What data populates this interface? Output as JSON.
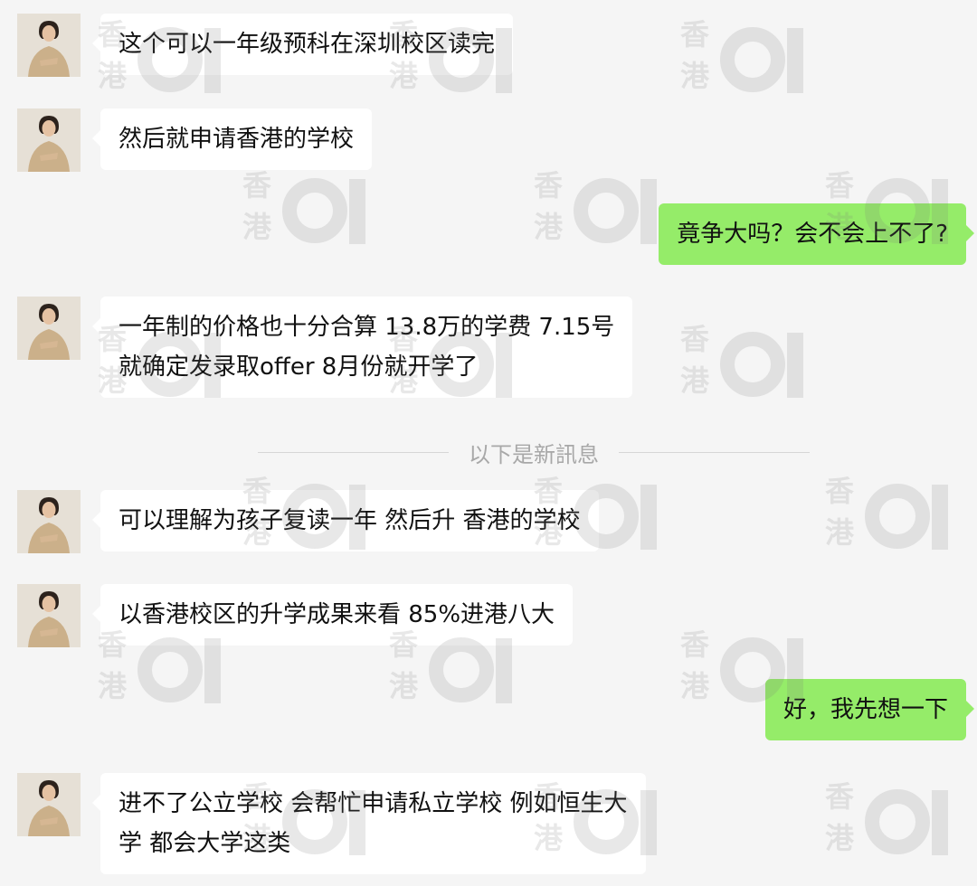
{
  "watermark": {
    "text": "香港",
    "logo_icon": "hk01-logo-icon"
  },
  "colors": {
    "background": "#f5f5f5",
    "incoming_bubble": "#ffffff",
    "outgoing_bubble": "#95ec69"
  },
  "messages": [
    {
      "sender": "other",
      "lines": [
        "这个可以一年级预科在深圳校区读完"
      ]
    },
    {
      "sender": "other",
      "lines": [
        "然后就申请香港的学校"
      ]
    },
    {
      "sender": "me",
      "lines": [
        "竟争大吗？会不会上不了?"
      ]
    },
    {
      "sender": "other",
      "lines": [
        "一年制的价格也十分合算 13.8万的学费  7.15号",
        "就确定发录取offer  8月份就开学了"
      ]
    },
    {
      "sender": "other",
      "lines": [
        "可以理解为孩子复读一年 然后升 香港的学校"
      ]
    },
    {
      "sender": "other",
      "lines": [
        "以香港校区的升学成果来看  85%进港八大"
      ]
    },
    {
      "sender": "me",
      "lines": [
        "好，我先想一下"
      ]
    },
    {
      "sender": "other",
      "lines": [
        "进不了公立学校 会帮忙申请私立学校 例如恒生大",
        "学 都会大学这类"
      ]
    }
  ],
  "divider": {
    "label": "以下是新訊息"
  }
}
